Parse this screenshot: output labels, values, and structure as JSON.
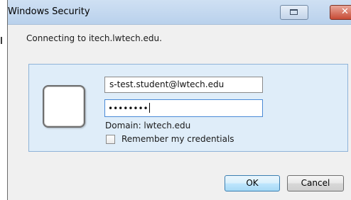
{
  "window": {
    "title": "Windows Security"
  },
  "dialog": {
    "connecting_text": "Connecting to itech.lwtech.edu."
  },
  "credentials": {
    "username_value": "s-test.student@lwtech.edu",
    "password_mask": "••••••••",
    "domain_text": "Domain: lwtech.edu",
    "remember_label": "Remember my credentials",
    "remember_checked": false
  },
  "buttons": {
    "ok_label": "OK",
    "cancel_label": "Cancel"
  },
  "icons": {
    "restore": "restore-icon",
    "close": "close-icon",
    "user_tile": "user-tile-icon"
  },
  "colors": {
    "panel_background": "#dfedf9",
    "panel_border": "#8fb3d8",
    "close_button": "#c74b35",
    "focused_field_border": "#4a8ad6"
  }
}
